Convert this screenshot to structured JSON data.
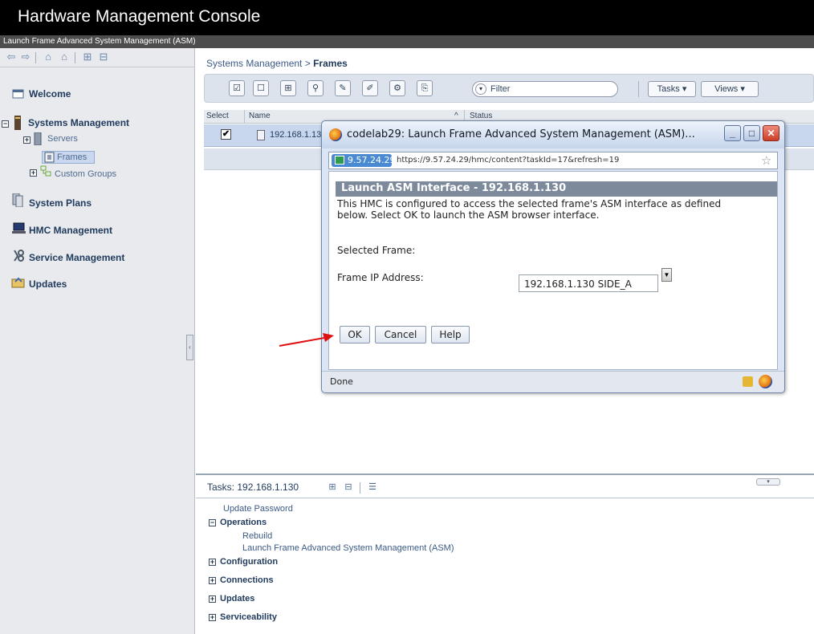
{
  "app": {
    "title": "Hardware Management Console",
    "subtitle": "Launch Frame Advanced System Management (ASM)"
  },
  "nav_toolbar": {
    "icons": [
      "back-icon",
      "forward-icon",
      "home-icon",
      "favorite-home-icon",
      "expand-all-icon",
      "collapse-all-icon"
    ]
  },
  "nav": {
    "welcome": "Welcome",
    "systems_management": "Systems Management",
    "servers": "Servers",
    "frames": "Frames",
    "custom_groups": "Custom Groups",
    "system_plans": "System Plans",
    "hmc_management": "HMC Management",
    "service_management": "Service Management",
    "updates": "Updates"
  },
  "breadcrumb": {
    "parent": "Systems Management",
    "separator": ">",
    "current": "Frames"
  },
  "toolbar": {
    "filter_placeholder": "Filter",
    "tasks_label": "Tasks ▾",
    "views_label": "Views ▾"
  },
  "table": {
    "headers": {
      "select": "Select",
      "name": "Name",
      "sort_indicator": "^",
      "status": "Status"
    },
    "rows": [
      {
        "checked": "✔",
        "name": "192.168.1.13"
      }
    ]
  },
  "tasks_pane": {
    "title": "Tasks: 192.168.1.130",
    "update_password": "Update Password",
    "operations": "Operations",
    "rebuild": "Rebuild",
    "launch_asm": "Launch Frame Advanced System Management (ASM)",
    "configuration": "Configuration",
    "connections": "Connections",
    "updates": "Updates",
    "serviceability": "Serviceability"
  },
  "dialog": {
    "window_title": "codelab29: Launch Frame Advanced System Management (ASM)...",
    "site_label": "9.57.24.29",
    "url": "https://9.57.24.29/hmc/content?taskId=17&refresh=19",
    "header": "Launch ASM Interface - 192.168.1.130",
    "description": "This HMC is configured to access the selected frame's ASM interface as defined below. Select OK to launch the ASM browser interface.",
    "selected_frame_label": "Selected Frame:",
    "frame_ip_label": "Frame IP Address:",
    "frame_ip_value": "192.168.1.130 SIDE_A",
    "ok": "OK",
    "cancel": "Cancel",
    "help": "Help",
    "status": "Done"
  },
  "colors": {
    "header_bg": "#000000",
    "subheader_bg": "#4d4d4d",
    "nav_bg": "#e8eaee",
    "selected_row": "#c8d6ee",
    "asm_header_bg": "#7d8a9b",
    "arrow": "#e01010"
  }
}
